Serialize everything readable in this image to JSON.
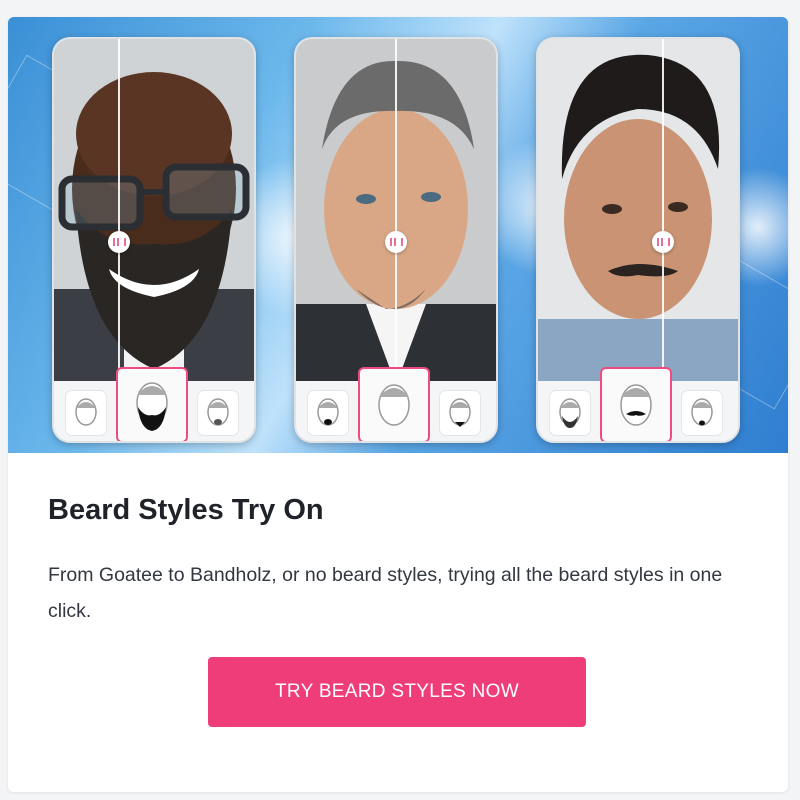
{
  "card": {
    "title": "Beard Styles Try On",
    "description": "From Goatee to Bandholz, or no beard styles, trying all the beard styles in one click.",
    "cta_label": "TRY BEARD STYLES NOW"
  },
  "colors": {
    "accent": "#ef3d79",
    "selected_border": "#ef4b82",
    "hero_blue": "#3a8fd6"
  },
  "hero": {
    "phones": [
      {
        "name": "bald man with glasses",
        "thumbnails": [
          "no-beard-face-icon",
          "full-beard-face-icon",
          "goatee-face-icon"
        ],
        "selected_index": 1
      },
      {
        "name": "grey-haired man",
        "thumbnails": [
          "goatee-face-icon",
          "no-beard-face-icon",
          "chin-strap-face-icon"
        ],
        "selected_index": 1
      },
      {
        "name": "dark-haired man with mustache",
        "thumbnails": [
          "beard-face-icon",
          "mustache-face-icon",
          "small-goatee-face-icon"
        ],
        "selected_index": 1
      }
    ]
  }
}
